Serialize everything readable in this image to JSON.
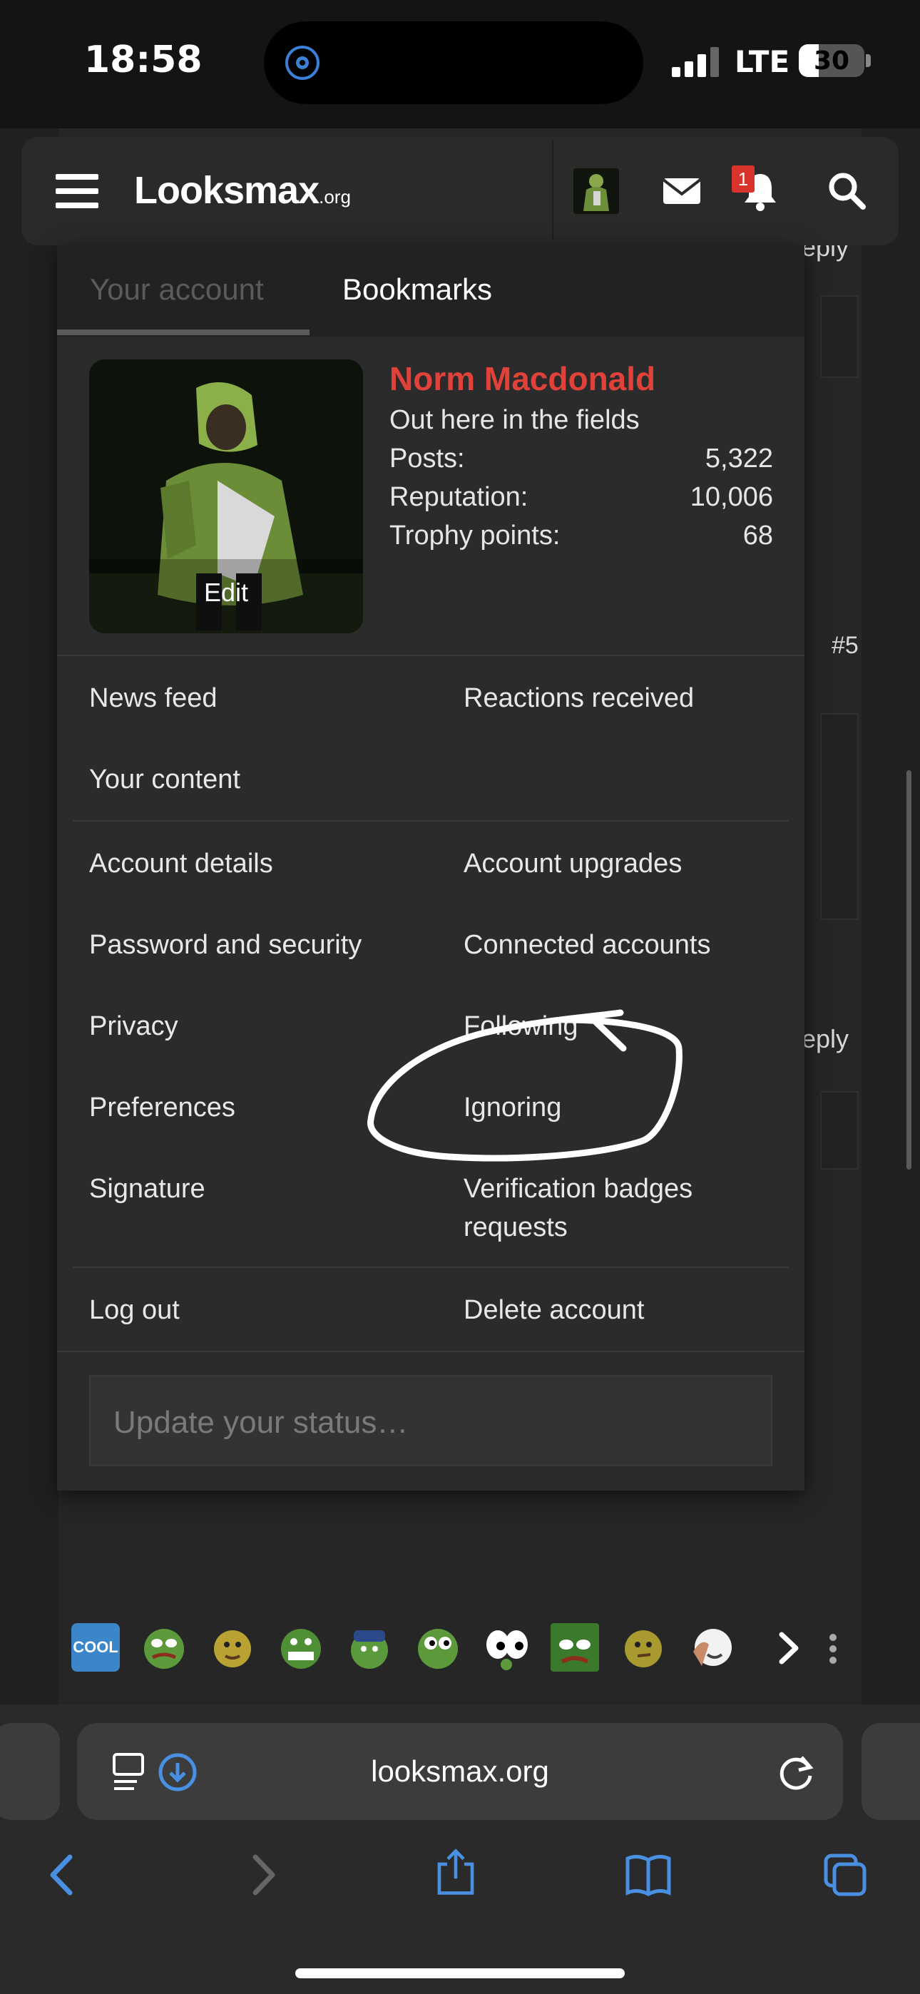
{
  "status_bar": {
    "time": "18:58",
    "network": "LTE",
    "battery": "30",
    "battery_level": 0.3
  },
  "header": {
    "logo_main": "Looksmax",
    "logo_suffix": ".org",
    "notification_count": "1"
  },
  "background": {
    "reply_1": "eply",
    "post_number": "#5",
    "reply_2": "eply"
  },
  "menu": {
    "tabs": [
      {
        "label": "Your account",
        "active": true
      },
      {
        "label": "Bookmarks",
        "active": false
      }
    ],
    "profile": {
      "edit_label": "Edit",
      "username": "Norm Macdonald",
      "user_title": "Out here in the fields",
      "stats": [
        {
          "key": "Posts:",
          "value": "5,322"
        },
        {
          "key": "Reputation:",
          "value": "10,006"
        },
        {
          "key": "Trophy points:",
          "value": "68"
        }
      ]
    },
    "links": {
      "news_feed": "News feed",
      "reactions_received": "Reactions received",
      "your_content": "Your content",
      "account_details": "Account details",
      "account_upgrades": "Account upgrades",
      "password_security": "Password and security",
      "connected_accounts": "Connected accounts",
      "privacy": "Privacy",
      "following": "Following",
      "preferences": "Preferences",
      "ignoring": "Ignoring",
      "signature": "Signature",
      "verification": "Verification badges requests",
      "log_out": "Log out",
      "delete_account": "Delete account"
    },
    "status_placeholder": "Update your status…"
  },
  "emoji_bar": {
    "cool_label": "COOL"
  },
  "browser": {
    "url": "looksmax.org"
  },
  "colors": {
    "username": "#e0423a",
    "badge": "#d9342b",
    "accent_blue": "#4a90e2"
  }
}
